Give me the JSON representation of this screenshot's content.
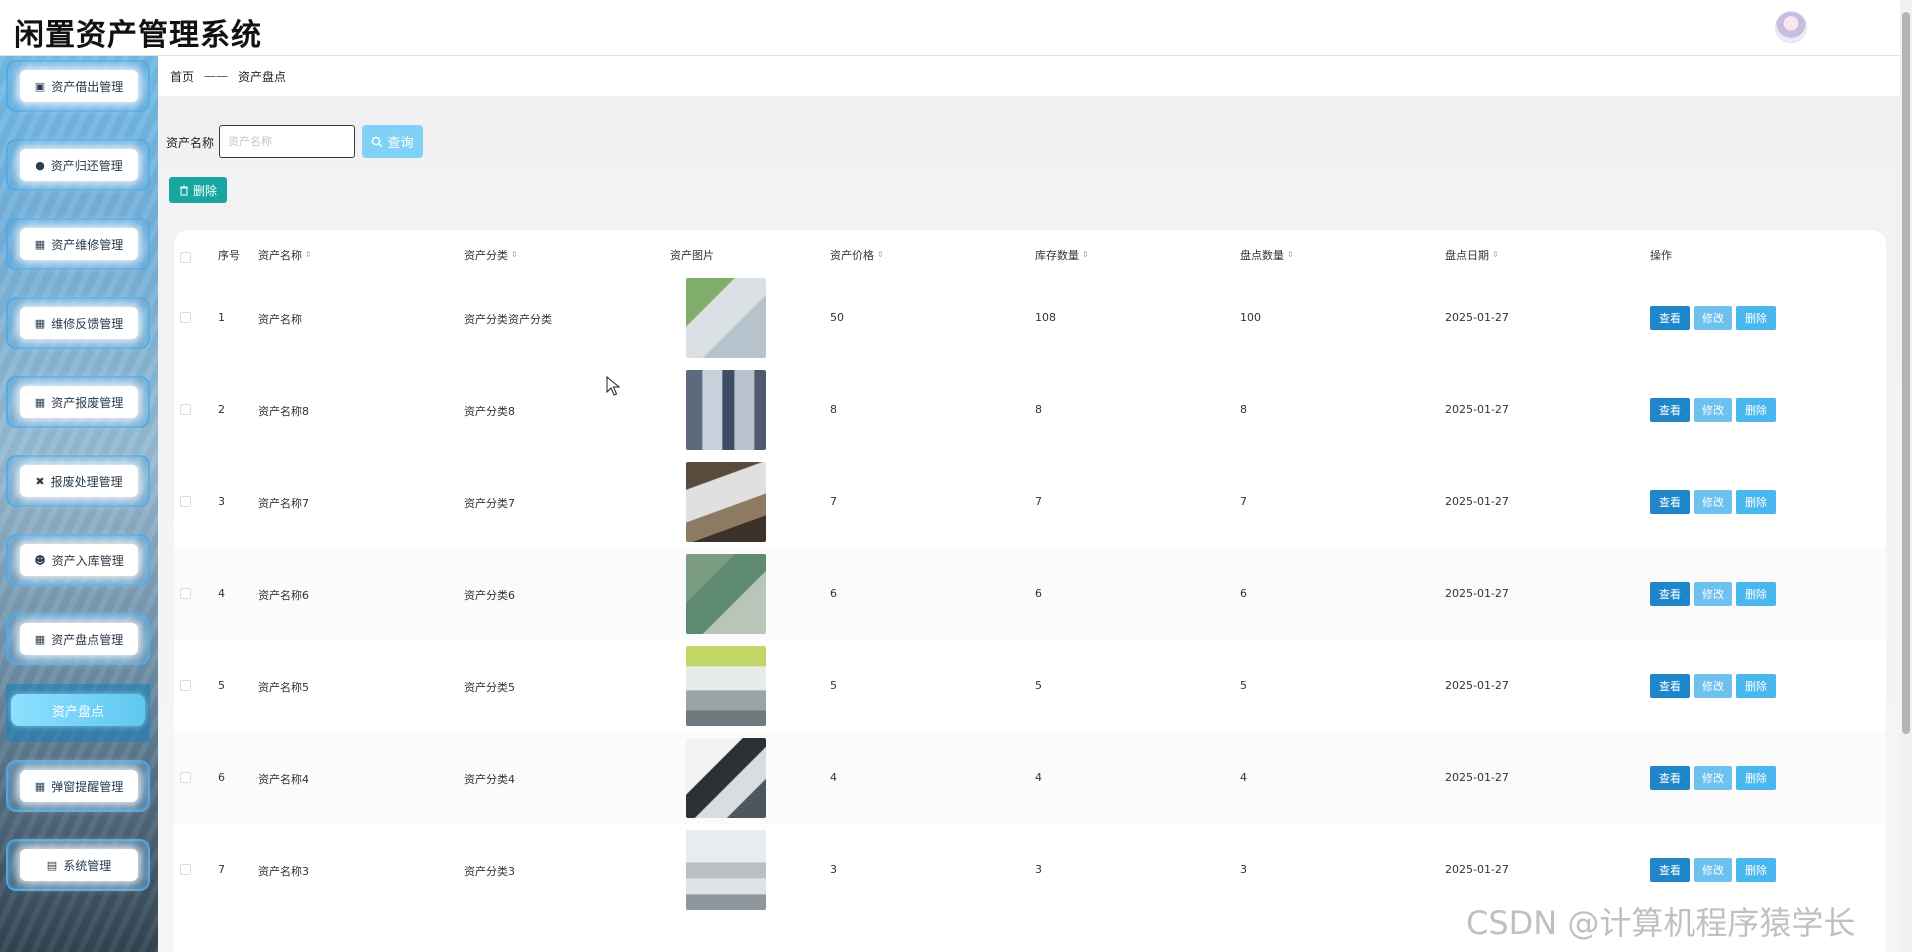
{
  "header": {
    "title": "闲置资产管理系统",
    "avatar_icon": "anime-avatar-icon"
  },
  "sidebar": {
    "items": [
      {
        "label": "资产借出管理",
        "icon": "briefcase-icon"
      },
      {
        "label": "资产归还管理",
        "icon": "location-pin-icon"
      },
      {
        "label": "资产维修管理",
        "icon": "grid-icon"
      },
      {
        "label": "维修反馈管理",
        "icon": "grid-icon"
      },
      {
        "label": "资产报废管理",
        "icon": "grid-icon"
      },
      {
        "label": "报废处理管理",
        "icon": "ticket-icon"
      },
      {
        "label": "资产入库管理",
        "icon": "user-icon"
      },
      {
        "label": "资产盘点管理",
        "icon": "grid-icon"
      },
      {
        "label": "弹窗提醒管理",
        "icon": "grid-icon"
      },
      {
        "label": "系统管理",
        "icon": "chart-icon"
      }
    ],
    "active_subitem": "资产盘点"
  },
  "breadcrumb": {
    "home": "首页",
    "separator": "——",
    "current": "资产盘点"
  },
  "search": {
    "label": "资产名称",
    "placeholder": "资产名称",
    "value": "",
    "button_label": "查询"
  },
  "toolbar": {
    "delete_label": "删除"
  },
  "table": {
    "columns": [
      "序号",
      "资产名称",
      "资产分类",
      "资产图片",
      "资产价格",
      "库存数量",
      "盘点数量",
      "盘点日期",
      "操作"
    ],
    "rows": [
      {
        "index": "1",
        "name": "资产名称",
        "category": "资产分类资产分类",
        "price": "50",
        "stock": "108",
        "counted": "100",
        "date": "2025-01-27",
        "image": "thermometer-photo"
      },
      {
        "index": "2",
        "name": "资产名称8",
        "category": "资产分类8",
        "price": "8",
        "stock": "8",
        "counted": "8",
        "date": "2025-01-27",
        "image": "cabinet-photo"
      },
      {
        "index": "3",
        "name": "资产名称7",
        "category": "资产分类7",
        "price": "7",
        "stock": "7",
        "counted": "7",
        "date": "2025-01-27",
        "image": "machine-photo"
      },
      {
        "index": "4",
        "name": "资产名称6",
        "category": "资产分类6",
        "price": "6",
        "stock": "6",
        "counted": "6",
        "date": "2025-01-27",
        "image": "mixer-photo"
      },
      {
        "index": "5",
        "name": "资产名称5",
        "category": "资产分类5",
        "price": "5",
        "stock": "5",
        "counted": "5",
        "date": "2025-01-27",
        "image": "lab-photo"
      },
      {
        "index": "6",
        "name": "资产名称4",
        "category": "资产分类4",
        "price": "4",
        "stock": "4",
        "counted": "4",
        "date": "2025-01-27",
        "image": "microscope-photo"
      },
      {
        "index": "7",
        "name": "资产名称3",
        "category": "资产分类3",
        "price": "3",
        "stock": "3",
        "counted": "3",
        "date": "2025-01-27",
        "image": "lab-room-photo"
      }
    ],
    "actions": {
      "view": "查看",
      "edit": "修改",
      "delete": "删除"
    }
  },
  "watermark": "CSDN @计算机程序猿学长",
  "colors": {
    "view_button": "#1f86c9",
    "edit_button": "#6dc1ec",
    "delete_button": "#49b7ee",
    "batch_delete_button": "#18a7a0",
    "search_button": "#7fd2f3"
  }
}
